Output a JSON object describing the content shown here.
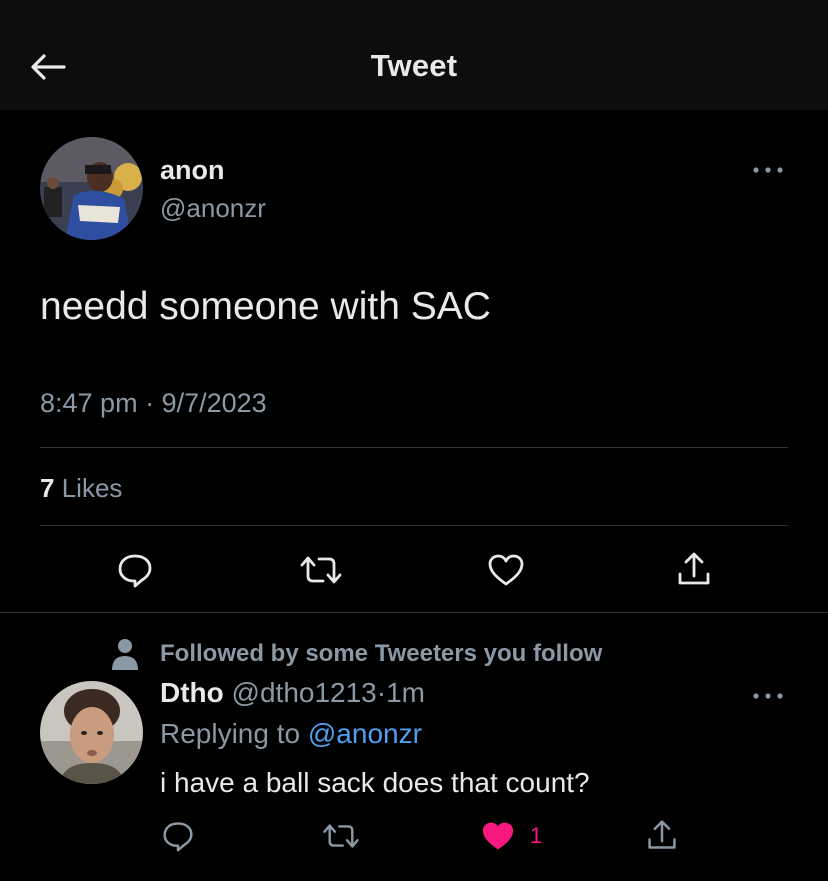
{
  "header": {
    "title": "Tweet"
  },
  "tweet": {
    "author_name": "anon",
    "author_handle": "@anonzr",
    "text": "needd someone with SAC",
    "time": "8:47 pm",
    "date": "9/7/2023",
    "timestamp_sep": "·",
    "likes_count": "7",
    "likes_label": "Likes"
  },
  "reply": {
    "social_context": "Followed by some Tweeters you follow",
    "author_name": "Dtho",
    "author_handle": "@dtho1213",
    "time_sep": "·",
    "age": "1m",
    "replying_prefix": "Replying to",
    "replying_mention": "@anonzr",
    "text": "i have a ball sack does that count?",
    "like_count": "1"
  },
  "colors": {
    "background": "#000000",
    "header_bg": "#0d0d0d",
    "primary_text": "#e7e9ea",
    "secondary_text": "#8b98a5",
    "link": "#4f9ff0",
    "like_active": "#f91880",
    "divider": "#2f3336"
  },
  "icons": {
    "back": "arrow-left-icon",
    "more": "more-horizontal-icon",
    "reply": "reply-icon",
    "retweet": "retweet-icon",
    "like": "heart-icon",
    "share": "share-icon",
    "person": "person-icon"
  }
}
